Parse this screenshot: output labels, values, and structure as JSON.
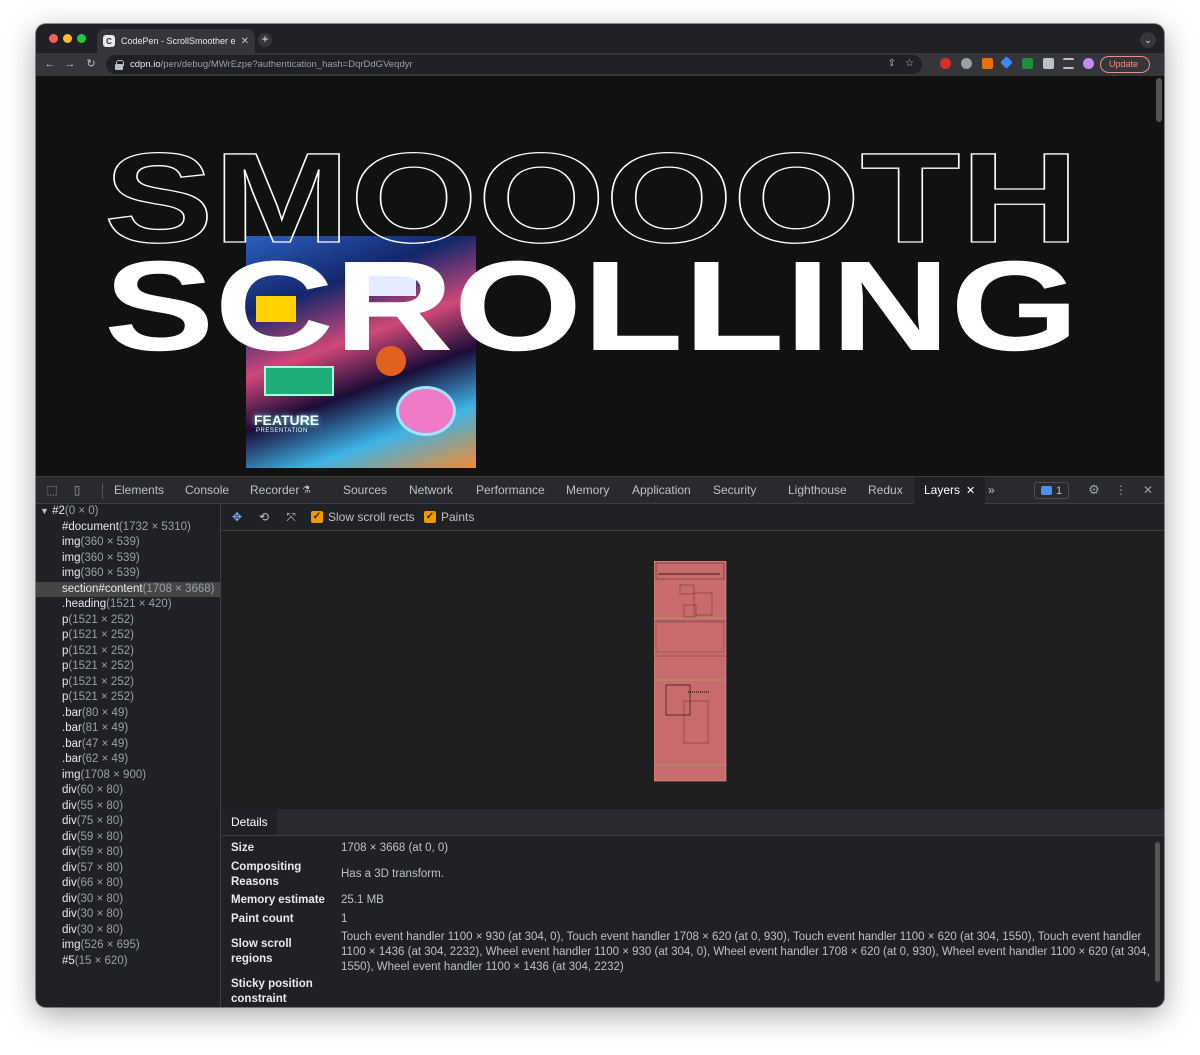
{
  "browser": {
    "tab_title": "CodePen - ScrollSmoother exp",
    "favicon_letter": "C",
    "new_tab_label": "+",
    "url_host": "cdpn.io",
    "url_path": "/pen/debug/MWrEzpe?authentication_hash=DqrDdGVeqdyr",
    "update_label": "Update"
  },
  "page": {
    "heading_line1": "SMOOOOTH",
    "heading_line2": "SCROLLING",
    "image_sign": "FEATURE",
    "image_sign_sub": "PRESENTATION"
  },
  "devtools": {
    "tabs": [
      "Elements",
      "Console",
      "Recorder",
      "Sources",
      "Network",
      "Performance",
      "Memory",
      "Application",
      "Security",
      "Lighthouse",
      "Redux"
    ],
    "active_tab": "Layers",
    "issues_count": "1",
    "more_tabs": "»",
    "layers_toolbar": {
      "slow_scroll_label": "Slow scroll rects",
      "paints_label": "Paints"
    },
    "tree": {
      "root": {
        "name": "#2",
        "size": "(0 × 0)"
      },
      "rows": [
        {
          "name": "#document",
          "size": "(1732 × 5310)"
        },
        {
          "name": "img",
          "size": "(360 × 539)"
        },
        {
          "name": "img",
          "size": "(360 × 539)"
        },
        {
          "name": "img",
          "size": "(360 × 539)"
        },
        {
          "name": "section#content",
          "size": "(1708 × 3668)"
        },
        {
          "name": ".heading",
          "size": "(1521 × 420)"
        },
        {
          "name": "p",
          "size": "(1521 × 252)"
        },
        {
          "name": "p",
          "size": "(1521 × 252)"
        },
        {
          "name": "p",
          "size": "(1521 × 252)"
        },
        {
          "name": "p",
          "size": "(1521 × 252)"
        },
        {
          "name": "p",
          "size": "(1521 × 252)"
        },
        {
          "name": "p",
          "size": "(1521 × 252)"
        },
        {
          "name": ".bar",
          "size": "(80 × 49)"
        },
        {
          "name": ".bar",
          "size": "(81 × 49)"
        },
        {
          "name": ".bar",
          "size": "(47 × 49)"
        },
        {
          "name": ".bar",
          "size": "(62 × 49)"
        },
        {
          "name": "img",
          "size": "(1708 × 900)"
        },
        {
          "name": "div",
          "size": "(60 × 80)"
        },
        {
          "name": "div",
          "size": "(55 × 80)"
        },
        {
          "name": "div",
          "size": "(75 × 80)"
        },
        {
          "name": "div",
          "size": "(59 × 80)"
        },
        {
          "name": "div",
          "size": "(59 × 80)"
        },
        {
          "name": "div",
          "size": "(57 × 80)"
        },
        {
          "name": "div",
          "size": "(66 × 80)"
        },
        {
          "name": "div",
          "size": "(30 × 80)"
        },
        {
          "name": "div",
          "size": "(30 × 80)"
        },
        {
          "name": "div",
          "size": "(30 × 80)"
        },
        {
          "name": "img",
          "size": "(526 × 695)"
        },
        {
          "name": "#5",
          "size": "(15 × 620)"
        }
      ]
    },
    "details": {
      "tab_label": "Details",
      "size_label": "Size",
      "size_value": "1708 × 3668 (at 0, 0)",
      "compositing_label": "Compositing Reasons",
      "compositing_value": "Has a 3D transform.",
      "memory_label": "Memory estimate",
      "memory_value": "25.1 MB",
      "paint_label": "Paint count",
      "paint_value": "1",
      "slow_scroll_label": "Slow scroll regions",
      "slow_scroll_value": "Touch event handler 1100 × 930 (at 304, 0), Touch event handler 1708 × 620 (at 0, 930), Touch event handler 1100 × 620 (at 304, 1550), Touch event handler 1100 × 1436 (at 304, 2232), Wheel event handler 1100 × 930 (at 304, 0), Wheel event handler 1708 × 620 (at 0, 930), Wheel event handler 1100 × 620 (at 304, 1550), Wheel event handler 1100 × 1436 (at 304, 2232)",
      "sticky_label": "Sticky position constraint"
    }
  },
  "colors": {
    "layer_fill": "#c96a6c",
    "active_checkbox": "#f29900",
    "update_accent": "#f28b82"
  }
}
